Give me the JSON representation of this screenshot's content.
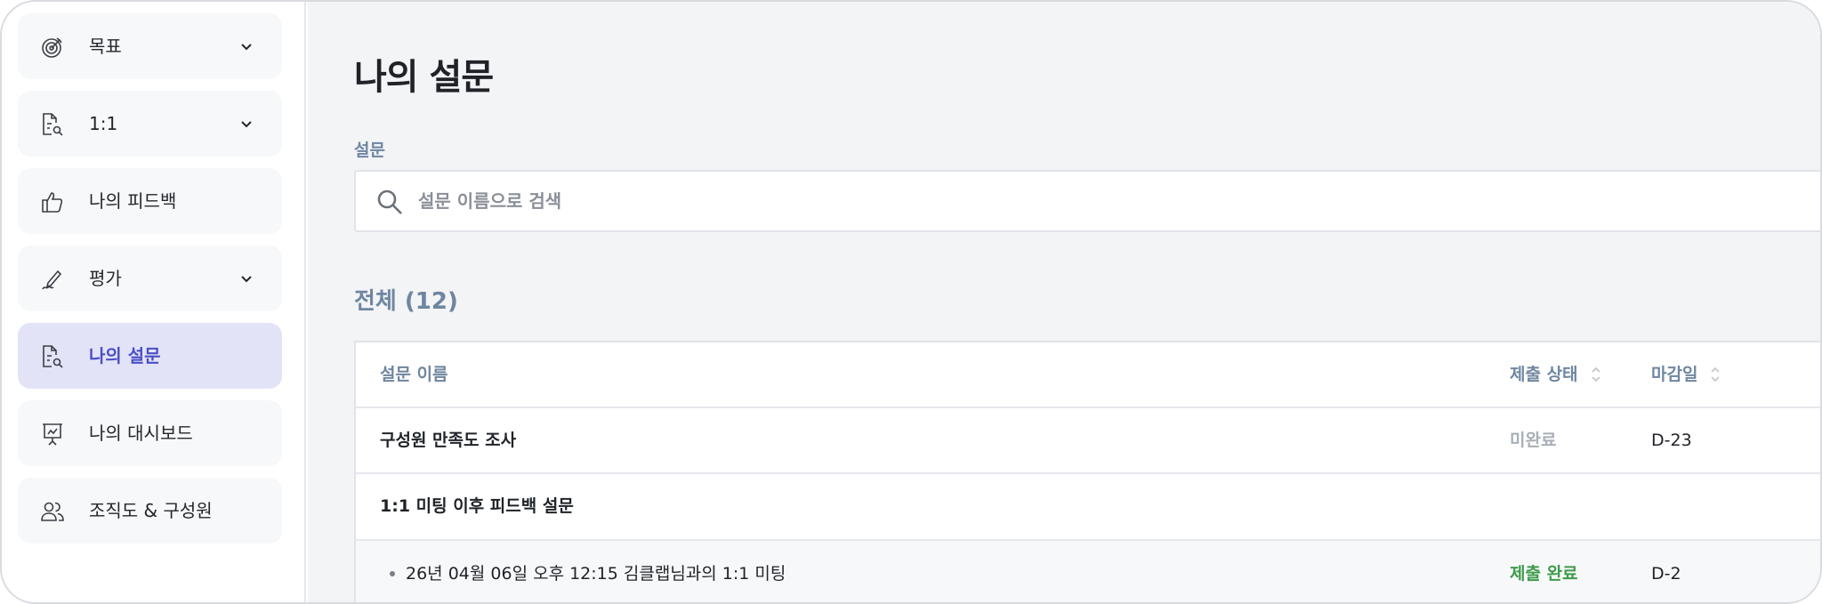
{
  "sidebar": {
    "items": [
      {
        "label": "목표",
        "icon": "target-icon",
        "expandable": true,
        "active": false
      },
      {
        "label": "1:1",
        "icon": "document-search-icon",
        "expandable": true,
        "active": false
      },
      {
        "label": "나의 피드백",
        "icon": "thumbs-up-icon",
        "expandable": false,
        "active": false
      },
      {
        "label": "평가",
        "icon": "pen-signature-icon",
        "expandable": true,
        "active": false
      },
      {
        "label": "나의 설문",
        "icon": "document-search-icon",
        "expandable": false,
        "active": true
      },
      {
        "label": "나의 대시보드",
        "icon": "presentation-chart-icon",
        "expandable": false,
        "active": false
      },
      {
        "label": "조직도 & 구성원",
        "icon": "users-icon",
        "expandable": false,
        "active": false
      }
    ]
  },
  "main": {
    "title": "나의 설문",
    "search": {
      "label": "설문",
      "placeholder": "설문 이름으로 검색",
      "value": ""
    },
    "count_title": "전체 (12)",
    "table": {
      "headers": {
        "name": "설문 이름",
        "status": "제출 상태",
        "due": "마감일"
      },
      "rows": [
        {
          "name": "구성원 만족도 조사",
          "status": "미완료",
          "due": "D-23"
        },
        {
          "name": "1:1 미팅 이후 피드백 설문",
          "status": "",
          "due": ""
        }
      ],
      "child_rows": [
        {
          "name": "26년 04월 06일 오후 12:15 김클랩님과의 1:1 미팅",
          "status": "제출 완료",
          "due": "D-2"
        }
      ]
    }
  },
  "colors": {
    "accent": "#4a4fc4",
    "active_bg": "#e3e3f8",
    "muted_label": "#6f86a1",
    "status_done": "#3f9b4a",
    "status_pending": "#a8afb8"
  }
}
